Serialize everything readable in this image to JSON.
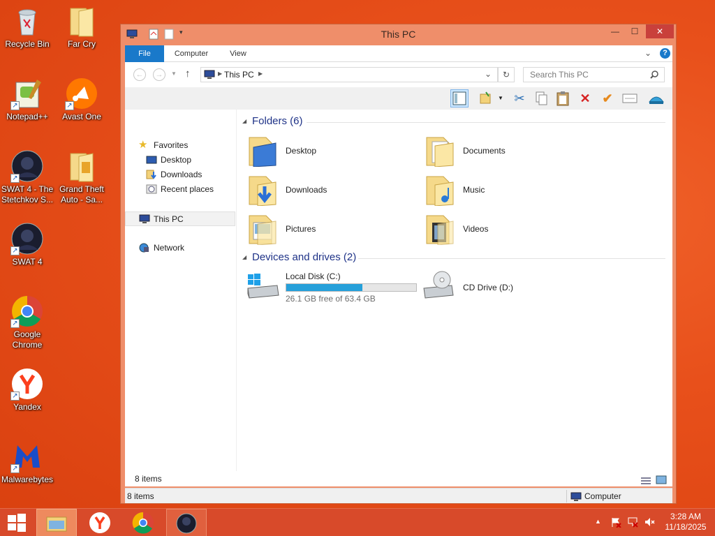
{
  "desktop": {
    "icons": [
      {
        "label": "Recycle Bin"
      },
      {
        "label": "Far Cry"
      },
      {
        "label": "Notepad++"
      },
      {
        "label": "Avast One"
      },
      {
        "label": "SWAT 4 - The Stetchkov S..."
      },
      {
        "label": "Grand Theft Auto - Sa..."
      },
      {
        "label": "SWAT 4"
      },
      {
        "label": "Google Chrome"
      },
      {
        "label": "Yandex"
      },
      {
        "label": "Malwarebytes"
      }
    ]
  },
  "window": {
    "title": "This PC",
    "controls": {
      "minimize": "—",
      "maximize": "☐",
      "close": "✕"
    },
    "ribbon": {
      "tabs": [
        {
          "label": "File"
        },
        {
          "label": "Computer"
        },
        {
          "label": "View"
        }
      ],
      "expand_icon": "chevron-down",
      "help": "?"
    },
    "address": {
      "back": "←",
      "forward": "→",
      "up": "↑",
      "path": "This PC",
      "refresh": "↻",
      "search_placeholder": "Search This PC"
    },
    "navigation": {
      "favorites_label": "Favorites",
      "favorites": [
        {
          "label": "Desktop"
        },
        {
          "label": "Downloads"
        },
        {
          "label": "Recent places"
        }
      ],
      "this_pc": "This PC",
      "network": "Network"
    },
    "folders_header": "Folders (6)",
    "folders": [
      {
        "label": "Desktop"
      },
      {
        "label": "Documents"
      },
      {
        "label": "Downloads"
      },
      {
        "label": "Music"
      },
      {
        "label": "Pictures"
      },
      {
        "label": "Videos"
      }
    ],
    "devices_header": "Devices and drives (2)",
    "drives": [
      {
        "label": "Local Disk (C:)",
        "free_text": "26.1 GB free of 63.4 GB",
        "used_fraction": 0.588
      },
      {
        "label": "CD Drive (D:)"
      }
    ],
    "status_items": "8 items",
    "status_bar": {
      "items": "8 items",
      "location": "Computer"
    }
  },
  "taskbar": {
    "time": "3:28 AM",
    "date": "11/18/2025"
  },
  "colors": {
    "accent": "#1979ca",
    "window_frame": "#ef8e6a",
    "close": "#c9403b",
    "group_header": "#1e3287",
    "progress": "#26a0da"
  }
}
